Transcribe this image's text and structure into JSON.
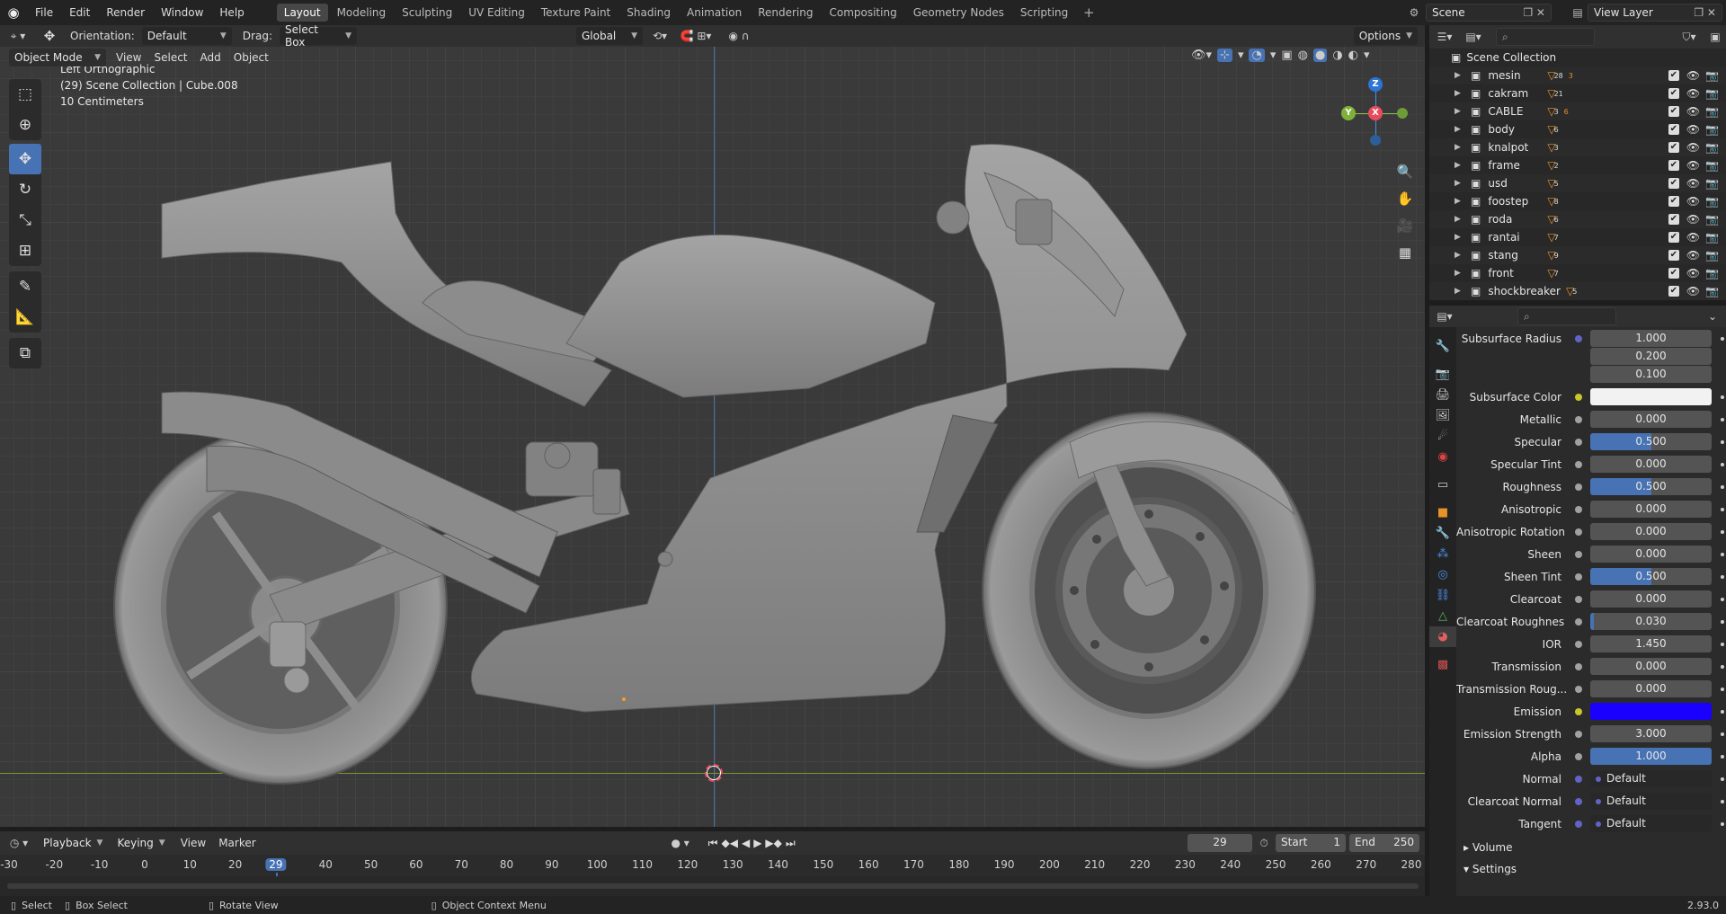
{
  "topbar": {
    "menus": [
      "File",
      "Edit",
      "Render",
      "Window",
      "Help"
    ],
    "workspaces": [
      "Layout",
      "Modeling",
      "Sculpting",
      "UV Editing",
      "Texture Paint",
      "Shading",
      "Animation",
      "Rendering",
      "Compositing",
      "Geometry Nodes",
      "Scripting"
    ],
    "active_workspace": "Layout",
    "add_tab": "+",
    "scene_name": "Scene",
    "view_layer": "View Layer"
  },
  "vp_header": {
    "orientation_label": "Orientation:",
    "orientation_value": "Default",
    "drag_label": "Drag:",
    "drag_value": "Select Box",
    "transform_orientation": "Global",
    "options": "Options"
  },
  "vp_header2": {
    "mode": "Object Mode",
    "menus": [
      "View",
      "Select",
      "Add",
      "Object"
    ]
  },
  "viewport": {
    "view_name": "Left Orthographic",
    "collection_info": "(29) Scene Collection | Cube.008",
    "scale": "10 Centimeters",
    "gizmo": {
      "z": "Z",
      "y": "Y",
      "x": "X"
    }
  },
  "outliner": {
    "root": "Scene Collection",
    "items": [
      {
        "name": "mesin",
        "badge": "28",
        "badge2": "3"
      },
      {
        "name": "cakram",
        "badge": "21",
        "badge2": ""
      },
      {
        "name": "CABLE",
        "badge": "3",
        "badge2": "6"
      },
      {
        "name": "body",
        "badge": "6",
        "badge2": ""
      },
      {
        "name": "knalpot",
        "badge": "3",
        "badge2": ""
      },
      {
        "name": "frame",
        "badge": "2",
        "badge2": ""
      },
      {
        "name": "usd",
        "badge": "5",
        "badge2": ""
      },
      {
        "name": "foostep",
        "badge": "8",
        "badge2": ""
      },
      {
        "name": "roda",
        "badge": "6",
        "badge2": ""
      },
      {
        "name": "rantai",
        "badge": "7",
        "badge2": ""
      },
      {
        "name": "stang",
        "badge": "9",
        "badge2": ""
      },
      {
        "name": "front",
        "badge": "7",
        "badge2": ""
      },
      {
        "name": "shockbreaker",
        "badge": "5",
        "badge2": ""
      }
    ]
  },
  "properties": {
    "subsurface_radius": {
      "label": "Subsurface Radius",
      "values": [
        "1.000",
        "0.200",
        "0.100"
      ]
    },
    "rows": [
      {
        "label": "Subsurface Color",
        "type": "color",
        "color": "#f2f2f2",
        "socket": "yellow"
      },
      {
        "label": "Metallic",
        "value": "0.000",
        "fill": 0,
        "socket": "grey"
      },
      {
        "label": "Specular",
        "value": "0.500",
        "fill": 0.5,
        "socket": "grey"
      },
      {
        "label": "Specular Tint",
        "value": "0.000",
        "fill": 0,
        "socket": "grey"
      },
      {
        "label": "Roughness",
        "value": "0.500",
        "fill": 0.5,
        "socket": "grey"
      },
      {
        "label": "Anisotropic",
        "value": "0.000",
        "fill": 0,
        "socket": "grey"
      },
      {
        "label": "Anisotropic Rotation",
        "value": "0.000",
        "fill": 0,
        "socket": "grey"
      },
      {
        "label": "Sheen",
        "value": "0.000",
        "fill": 0,
        "socket": "grey"
      },
      {
        "label": "Sheen Tint",
        "value": "0.500",
        "fill": 0.5,
        "socket": "grey"
      },
      {
        "label": "Clearcoat",
        "value": "0.000",
        "fill": 0,
        "socket": "grey"
      },
      {
        "label": "Clearcoat Roughnes",
        "value": "0.030",
        "fill": 0.03,
        "socket": "grey"
      },
      {
        "label": "IOR",
        "value": "1.450",
        "fill": 0,
        "socket": "grey"
      },
      {
        "label": "Transmission",
        "value": "0.000",
        "fill": 0,
        "socket": "grey"
      },
      {
        "label": "Transmission Roug...",
        "value": "0.000",
        "fill": 0,
        "socket": "grey"
      },
      {
        "label": "Emission",
        "type": "color",
        "color": "#1a00ff",
        "socket": "yellow"
      },
      {
        "label": "Emission Strength",
        "value": "3.000",
        "fill": 0,
        "socket": "grey"
      },
      {
        "label": "Alpha",
        "value": "1.000",
        "fill": 1,
        "socket": "grey"
      },
      {
        "label": "Normal",
        "type": "link",
        "value": "Default",
        "socket": "blue"
      },
      {
        "label": "Clearcoat Normal",
        "type": "link",
        "value": "Default",
        "socket": "blue"
      },
      {
        "label": "Tangent",
        "type": "link",
        "value": "Default",
        "socket": "blue"
      }
    ],
    "panels": [
      "Volume",
      "Settings"
    ]
  },
  "timeline": {
    "menus": [
      "Playback",
      "Keying",
      "View",
      "Marker"
    ],
    "current_frame": "29",
    "start_label": "Start",
    "start": "1",
    "end_label": "End",
    "end": "250",
    "ticks": [
      "-30",
      "-20",
      "-10",
      "0",
      "10",
      "20",
      "29",
      "40",
      "50",
      "60",
      "70",
      "80",
      "90",
      "100",
      "110",
      "120",
      "130",
      "140",
      "150",
      "160",
      "170",
      "180",
      "190",
      "200",
      "210",
      "220",
      "230",
      "240",
      "250",
      "260",
      "270",
      "280"
    ]
  },
  "statusbar": {
    "select": "Select",
    "box_select": "Box Select",
    "rotate": "Rotate View",
    "context": "Object Context Menu",
    "version": "2.93.0"
  },
  "colors": {
    "accent": "#4772b3",
    "x_axis": "#e84c5c",
    "y_axis": "#8bc34a",
    "z_axis": "#4a8fe8"
  }
}
